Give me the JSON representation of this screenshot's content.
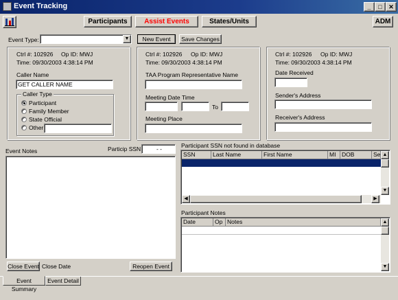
{
  "window": {
    "title": "Event Tracking"
  },
  "nav": {
    "participants": "Participants",
    "assist_events": "Assist Events",
    "states_units": "States/Units",
    "adm": "ADM"
  },
  "toolbar": {
    "event_type_label": "Event Type:",
    "event_type_value": "",
    "new_event": "New Event",
    "save_changes": "Save Changes"
  },
  "panel1": {
    "ctrl": "Ctrl #: 102926",
    "opid": "Op ID:  MWJ",
    "time": "Time: 09/30/2003 4:38:14 PM",
    "caller_name_label": "Caller Name",
    "caller_name_value": "GET CALLER NAME",
    "caller_type_label": "Caller Type",
    "caller_types": [
      "Participant",
      "Family Member",
      "State Official",
      "Other"
    ],
    "other_value": ""
  },
  "panel2": {
    "ctrl": "Ctrl #: 102926",
    "opid": "Op ID:  MWJ",
    "time": "Time: 09/30/2003 4:38:14 PM",
    "rep_label": "TAA Program Representative Name",
    "meeting_date_label": "Meeting Date",
    "time_label": "Time",
    "to_label": "To",
    "meeting_place_label": "Meeting Place"
  },
  "panel3": {
    "ctrl": "Ctrl #: 102926",
    "opid": "Op ID:  MWJ",
    "time": "Time: 09/30/2003 4:38:14 PM",
    "date_received_label": "Date Received",
    "senders_address_label": "Sender's Address",
    "receivers_address_label": "Receiver's Address"
  },
  "event_notes": {
    "label": "Event Notes",
    "ssn_label": "Particip SSN",
    "ssn_value": " -  -",
    "close_event": "Close Event",
    "close_date_label": "Close Date",
    "reopen_event": "Reopen Event"
  },
  "ssn_grid": {
    "caption": "Participant SSN not found in database",
    "columns": [
      "SSN",
      "Last Name",
      "First Name",
      "MI",
      "DOB",
      "Se"
    ]
  },
  "notes_grid": {
    "caption": "Participant Notes",
    "columns": [
      "Date",
      "Op",
      "Notes"
    ]
  },
  "tabs": {
    "summary": "Event Summary",
    "detail": "Event Detail"
  },
  "colors": {
    "title_start": "#0a246a",
    "active_nav": "#ff0000",
    "selection": "#0a246a"
  }
}
